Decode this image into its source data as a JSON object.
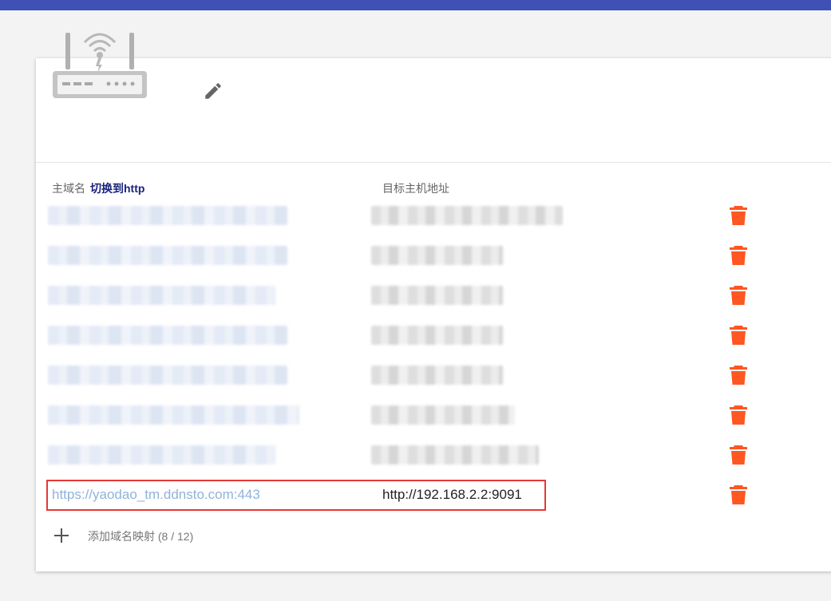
{
  "header": {
    "router_icon": "router-wifi-icon",
    "edit_icon": "pencil-icon"
  },
  "table": {
    "col_domain": "主域名",
    "switch_link": "切换到http",
    "col_target": "目标主机地址"
  },
  "rows": [
    {
      "domain": "",
      "target": ""
    },
    {
      "domain": "",
      "target": ""
    },
    {
      "domain": "",
      "target": ""
    },
    {
      "domain": "",
      "target": ""
    },
    {
      "domain": "",
      "target": ""
    },
    {
      "domain": "",
      "target": ""
    },
    {
      "domain": "",
      "target": ""
    },
    {
      "domain": "https://yaodao_tm.ddnsto.com:443",
      "target": "http://192.168.2.2:9091"
    }
  ],
  "footer": {
    "add_label": "添加域名映射 (8 / 12)",
    "add_icon": "plus-icon"
  },
  "colors": {
    "top_bar": "#3f51b5",
    "delete": "#ff5722",
    "link": "#8fb3da",
    "switch": "#1a237e",
    "highlight": "#e53935"
  }
}
